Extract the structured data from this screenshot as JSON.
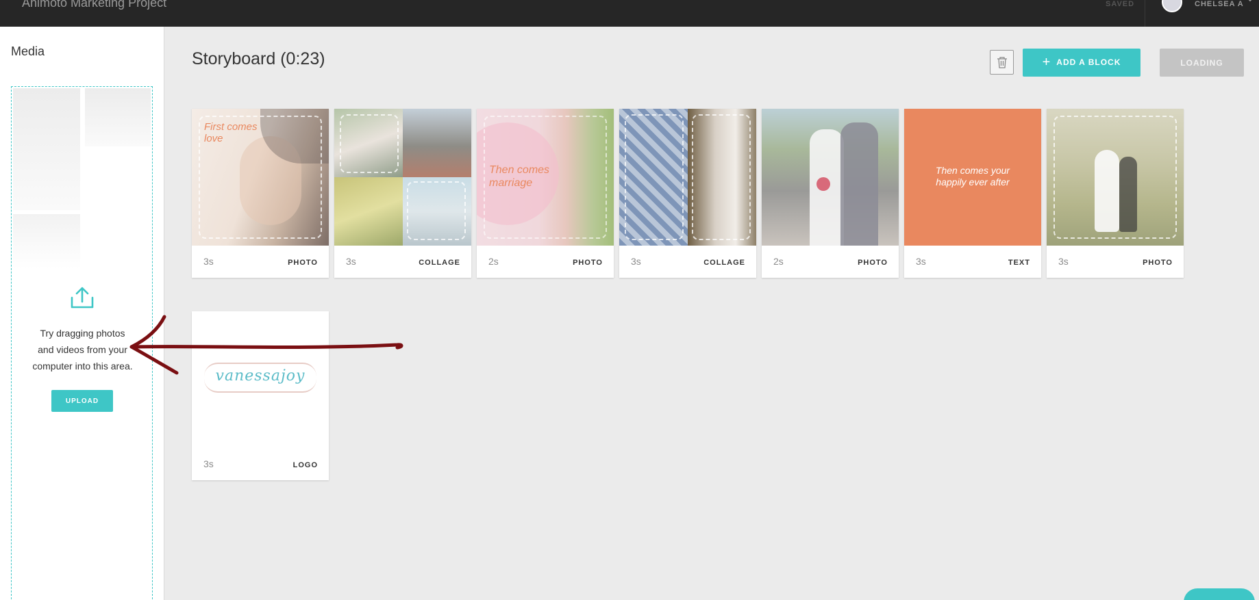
{
  "topbar": {
    "project_title": "Animoto Marketing Project",
    "saved_label": "SAVED",
    "username": "CHELSEA A"
  },
  "sidebar": {
    "title": "Media",
    "drop_text_line1": "Try dragging photos",
    "drop_text_line2": "and videos from your",
    "drop_text_line3": "computer into this area.",
    "upload_label": "UPLOAD"
  },
  "storyboard": {
    "title": "Storyboard (0:23)",
    "add_block_label": "ADD A BLOCK",
    "loading_label": "LOADING",
    "blocks": [
      {
        "duration": "3s",
        "type": "PHOTO",
        "caption": "First comes love"
      },
      {
        "duration": "3s",
        "type": "COLLAGE"
      },
      {
        "duration": "2s",
        "type": "PHOTO",
        "caption": "Then comes marriage"
      },
      {
        "duration": "3s",
        "type": "COLLAGE"
      },
      {
        "duration": "2s",
        "type": "PHOTO"
      },
      {
        "duration": "3s",
        "type": "TEXT",
        "caption": "Then comes your happily ever after"
      },
      {
        "duration": "3s",
        "type": "PHOTO"
      },
      {
        "duration": "3s",
        "type": "LOGO",
        "logo_text": "vanessajoy"
      }
    ]
  },
  "colors": {
    "accent": "#3ec6c6",
    "topbar": "#262626",
    "text_block": "#e9885f",
    "annotation_arrow": "#7a0f12"
  },
  "icons": {
    "upload": "upload-icon",
    "trash": "trash-icon",
    "plus": "plus-icon",
    "chevron": "chevron-down-icon"
  }
}
